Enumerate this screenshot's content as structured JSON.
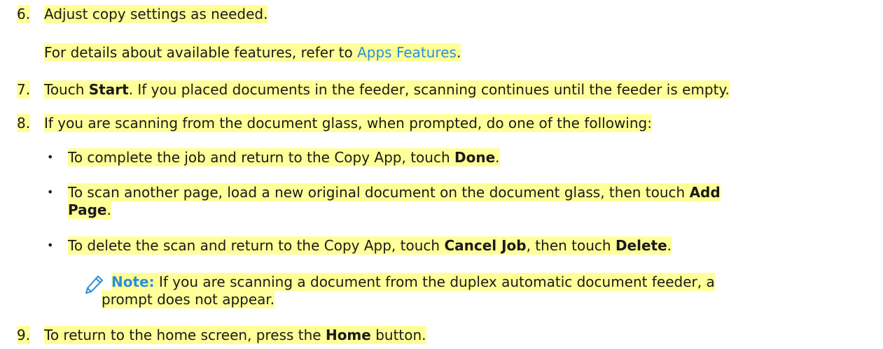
{
  "steps": [
    {
      "number": "6.",
      "text": "Adjust copy settings as needed.",
      "detail_prefix": "For details about available features, refer to ",
      "detail_link": "Apps Features",
      "detail_suffix": "."
    },
    {
      "number": "7.",
      "text_a": "Touch ",
      "bold_a": "Start",
      "text_b": ". If you placed documents in the feeder, scanning continues until the feeder is empty."
    },
    {
      "number": "8.",
      "text": "If you are scanning from the document glass, when prompted, do one of the following:"
    },
    {
      "number": "9.",
      "text_a": "To return to the home screen, press the ",
      "bold_a": "Home",
      "text_b": " button."
    }
  ],
  "bullets": [
    {
      "marker": "•",
      "text_a": "To complete the job and return to the Copy App, touch ",
      "bold_a": "Done",
      "text_b": "."
    },
    {
      "marker": "•",
      "text_a": "To scan another page, load a new original document on the document glass, then touch ",
      "bold_a": "Add",
      "bold_b": "Page",
      "text_b": "."
    },
    {
      "marker": "•",
      "text_a": "To delete the scan and return to the Copy App, touch ",
      "bold_a": "Cancel Job",
      "text_b": ", then touch ",
      "bold_b": "Delete",
      "text_c": "."
    }
  ],
  "note": {
    "icon": "pencil-icon",
    "label": "Note:",
    "line1": " If you are scanning a document from the duplex automatic document feeder, a",
    "line2": "prompt does not appear."
  },
  "colors": {
    "highlight": "#ffff99",
    "link": "#2a8fd6"
  }
}
